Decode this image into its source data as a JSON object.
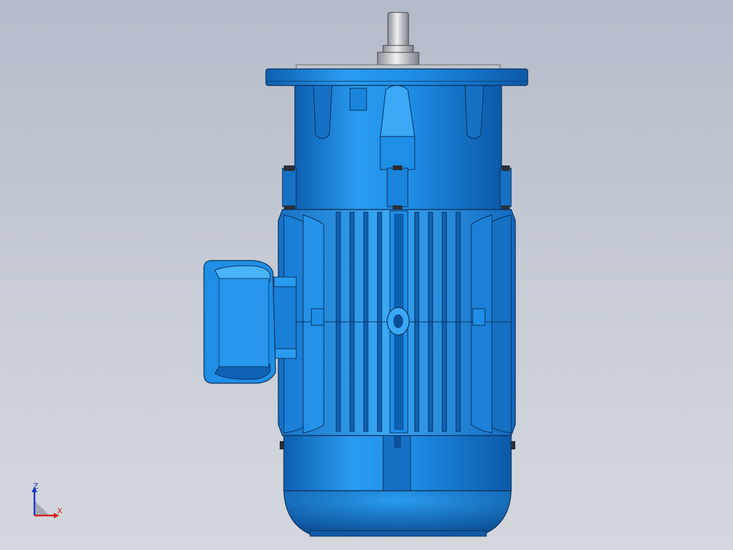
{
  "viewport": {
    "background_top": "#b4bcc9",
    "background_bottom": "#d4d7dd"
  },
  "model": {
    "body_color": "#1e8ee6",
    "dark_color": "#0a4f98",
    "shaft_color": "#c8ccd2"
  },
  "triad": {
    "z_label": "Z",
    "x_label": "X",
    "z_color": "#1a37c8",
    "x_color": "#d02020"
  }
}
